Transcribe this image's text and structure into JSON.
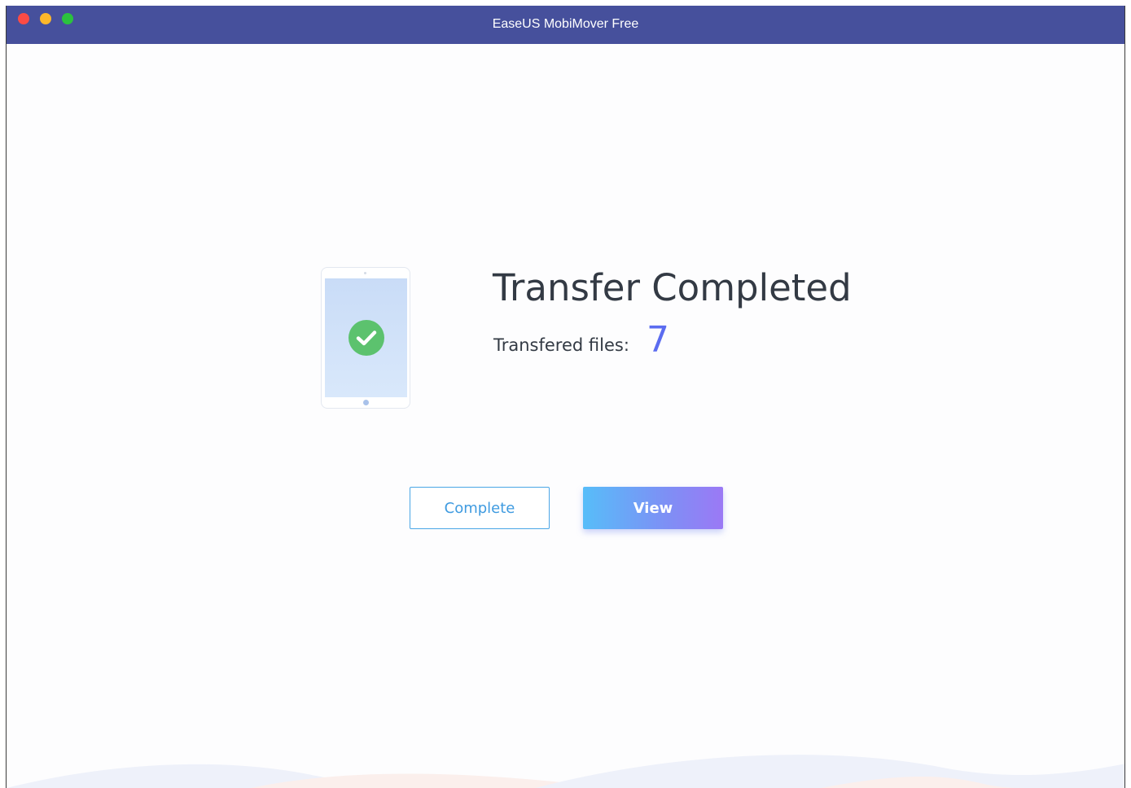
{
  "window": {
    "title": "EaseUS MobiMover Free",
    "controls": [
      "close",
      "minimize",
      "maximize"
    ]
  },
  "result": {
    "heading": "Transfer Completed",
    "files_label": "Transfered files:",
    "files_count": "7",
    "status_icon": "check-circle-icon"
  },
  "actions": {
    "complete_label": "Complete",
    "view_label": "View"
  },
  "colors": {
    "titlebar": "#46509c",
    "accent": "#5b6cf0",
    "success": "#5cc26e",
    "complete_border": "#4aa6e6"
  }
}
